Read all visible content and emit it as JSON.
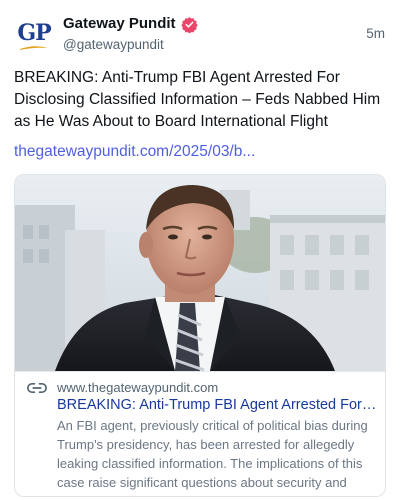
{
  "author": {
    "avatar_text": "GP",
    "display_name": "Gateway Pundit",
    "handle": "@gatewaypundit",
    "verified_icon": "verified-badge-icon"
  },
  "post": {
    "timestamp": "5m",
    "text": "BREAKING: Anti-Trump FBI Agent Arrested For Disclosing Classified Information – Feds Nabbed Him as He Was About to Board International Flight",
    "link_text": "thegatewaypundit.com/2025/03/b..."
  },
  "card": {
    "link_icon": "link-icon",
    "domain": "www.thegatewaypundit.com",
    "title": "BREAKING: Anti-Trump FBI Agent Arrested For Disclosing Classified Information",
    "description": "An FBI agent, previously critical of political bias during Trump's presidency, has been arrested for allegedly leaking classified information. The implications of this case raise significant questions about security and accountability."
  },
  "colors": {
    "verified": "#e8466a",
    "link": "#4f5fde",
    "card_title": "#17399c",
    "avatar_blue": "#1f3f8f",
    "avatar_gold": "#e3a21a"
  }
}
